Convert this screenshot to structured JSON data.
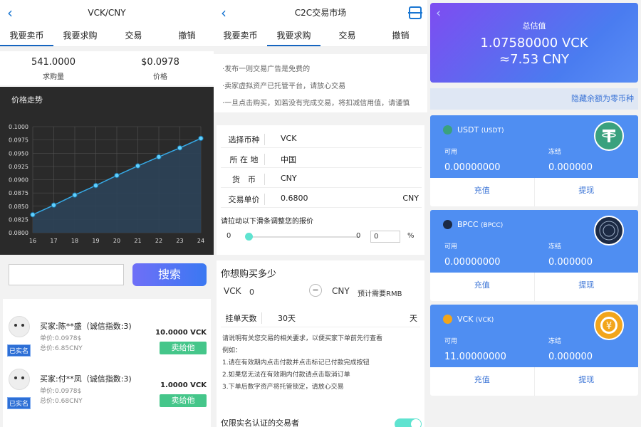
{
  "p1": {
    "title": "VCK/CNY",
    "tabs": [
      "我要卖币",
      "我要求购",
      "交易",
      "撤销"
    ],
    "stats": [
      {
        "value": "541.0000",
        "label": "求购量"
      },
      {
        "value": "$0.0978",
        "label": "价格"
      }
    ],
    "chart_title": "价格走势",
    "search_label": "搜索",
    "trades": [
      {
        "seller": "买家:陈**盛（诚信指数:3)",
        "unit": "单价:0.0978$",
        "total": "总价:6.85CNY",
        "amount": "10.0000 VCK",
        "sell": "卖给他",
        "badge": "已实名"
      },
      {
        "seller": "买家:付**凤（诚信指数:3)",
        "unit": "单价:0.0978$",
        "total": "总价:0.68CNY",
        "amount": "1.0000 VCK",
        "sell": "卖给他",
        "badge": "已实名"
      }
    ]
  },
  "chart_data": {
    "type": "area",
    "title": "价格走势",
    "categories": [
      "16",
      "17",
      "18",
      "19",
      "20",
      "21",
      "22",
      "23",
      "24"
    ],
    "values": [
      0.0834,
      0.0852,
      0.0871,
      0.0889,
      0.0908,
      0.0926,
      0.0943,
      0.096,
      0.0978
    ],
    "y_ticks": [
      "0.1000",
      "0.0975",
      "0.0950",
      "0.0925",
      "0.0900",
      "0.0875",
      "0.0850",
      "0.0825",
      "0.0800"
    ],
    "ylim": [
      0.08,
      0.1
    ],
    "grid": true,
    "colors": {
      "line": "#36a9e6",
      "fill": "#2c4258",
      "point": "#5fd0ff"
    }
  },
  "p2": {
    "title": "C2C交易市场",
    "tabs": [
      "我要卖币",
      "我要求购",
      "交易",
      "撤销"
    ],
    "notices": [
      "·发布一则交易广告是免费的",
      "·卖家虚拟资产已托管平台，请放心交易",
      "·一旦点击购买，如若没有完成交易，将扣减信用值，请谨慎"
    ],
    "form": [
      {
        "label": "选择币种",
        "value": "VCK",
        "unit": ""
      },
      {
        "label": "所 在 地",
        "value": "中国",
        "unit": ""
      },
      {
        "label": "货　币",
        "value": "CNY",
        "unit": ""
      },
      {
        "label": "交易单价",
        "value": "0.6800",
        "unit": "CNY"
      }
    ],
    "slider_label": "请拉动以下滑条调整您的报价",
    "slider_min": "0",
    "slider_max": "0",
    "slider_value": "0",
    "slider_unit": "%",
    "buy_title": "你想购买多少",
    "buy_coin": "VCK",
    "buy_amount": "0",
    "buy_currency": "CNY",
    "buy_need": "预计需要RMB",
    "days_label": "挂单天数",
    "days_value": "30天",
    "days_unit": "天",
    "desc": [
      "请说明有关您交易的相关要求，以便买家下单前先行查看",
      "例如：",
      "1.请在有效期内点击付款并点击标记已付款完成按钮",
      "2.如果您无法在有效期内付款请点击取消订单",
      "3.下单后数字资产将托管锁定，请放心交易"
    ],
    "toggle_label": "仅限实名认证的交易者"
  },
  "p3": {
    "hero_title": "总估值",
    "hero_vck": "1.07580000 VCK",
    "hero_cny": "≈7.53 CNY",
    "hide_label": "隐藏余额为零币种",
    "coins": [
      {
        "name": "USDT",
        "sub": "(USDT)",
        "avail_label": "可用",
        "frozen_label": "冻结",
        "avail": "0.00000000",
        "frozen": "0.000000",
        "deposit": "充值",
        "withdraw": "提现",
        "color": "#3aa17e"
      },
      {
        "name": "BPCC",
        "sub": "(BPCC)",
        "avail_label": "可用",
        "frozen_label": "冻结",
        "avail": "0.00000000",
        "frozen": "0.000000",
        "deposit": "充值",
        "withdraw": "提现",
        "color": "#1c2a44"
      },
      {
        "name": "VCK",
        "sub": "(VCK)",
        "avail_label": "可用",
        "frozen_label": "冻结",
        "avail": "11.00000000",
        "frozen": "0.000000",
        "deposit": "充值",
        "withdraw": "提现",
        "color": "#f2a51b"
      }
    ]
  }
}
